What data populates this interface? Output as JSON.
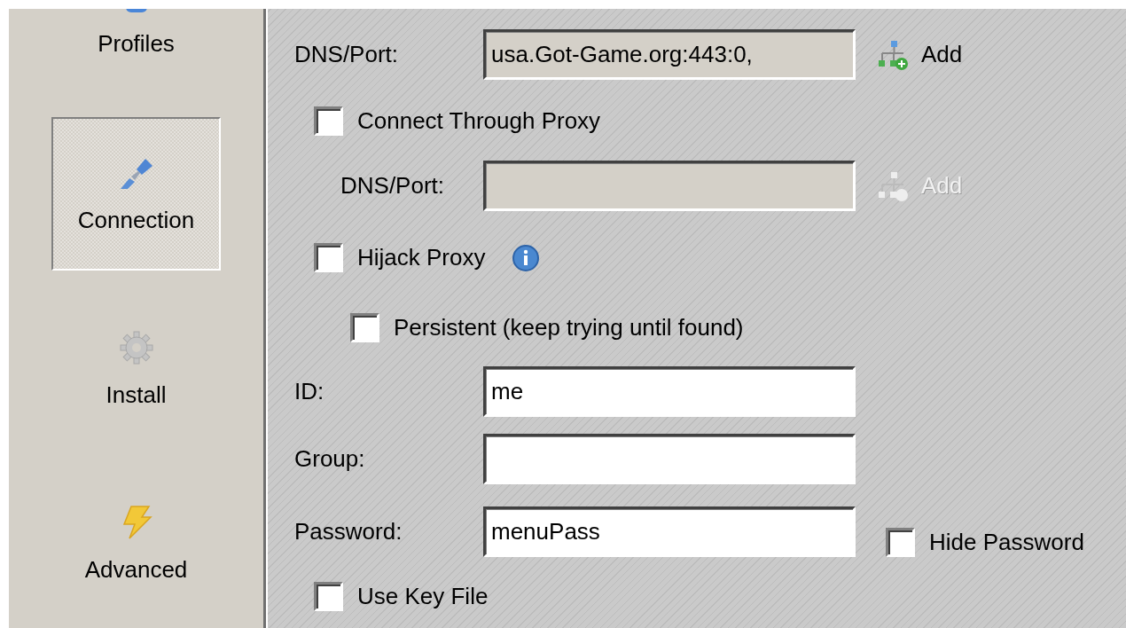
{
  "sidebar": {
    "items": [
      {
        "label": "Profiles",
        "selected": false
      },
      {
        "label": "Connection",
        "selected": true
      },
      {
        "label": "Install",
        "selected": false
      },
      {
        "label": "Advanced",
        "selected": false
      }
    ]
  },
  "form": {
    "rows": [
      {
        "kind": "field",
        "label": "DNS/Port:",
        "value": "usa.Got-Game.org:443:0,",
        "readonly": true,
        "disabled": false,
        "add_button": {
          "label": "Add",
          "disabled": false
        }
      },
      {
        "kind": "checkbox",
        "label": "Connect Through Proxy",
        "checked": false,
        "children": [
          {
            "kind": "field",
            "label": "DNS/Port:",
            "disabled": true,
            "add_button": {
              "label": "Add",
              "disabled": true
            }
          }
        ]
      },
      {
        "kind": "checkbox",
        "label": "Hijack Proxy",
        "checked": false,
        "info": true,
        "children": [
          {
            "kind": "checkbox",
            "label": "Persistent (keep trying until found)",
            "checked": false
          }
        ]
      },
      {
        "kind": "field",
        "label": "ID:",
        "value": "me",
        "disabled": false
      },
      {
        "kind": "field",
        "label": "Group:",
        "disabled": false
      },
      {
        "kind": "field",
        "label": "Password:",
        "value": "menuPass",
        "disabled": false,
        "side_checkbox": {
          "label": "Hide Password",
          "checked": false
        }
      },
      {
        "kind": "checkbox",
        "label": "Use Key File",
        "checked": false
      }
    ]
  }
}
